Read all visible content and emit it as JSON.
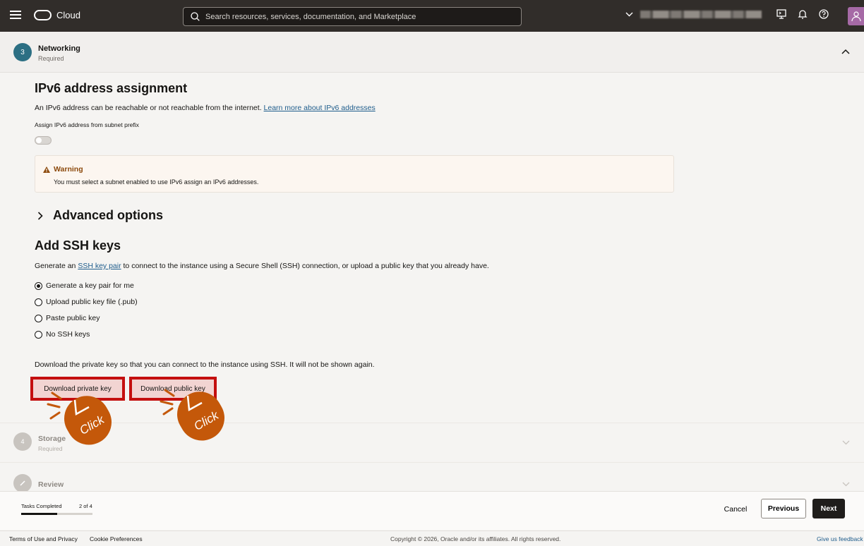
{
  "topbar": {
    "logo_text": "Cloud",
    "search_placeholder": "Search resources, services, documentation, and Marketplace"
  },
  "step3": {
    "number": "3",
    "title": "Networking",
    "subtitle": "Required"
  },
  "ipv6": {
    "heading": "IPv6 address assignment",
    "description": "An IPv6 address can be reachable or not reachable from the internet.",
    "learn_more": "Learn more about IPv6 addresses",
    "toggle_label": "Assign IPv6 address from subnet prefix",
    "toggle_on": false,
    "warning_title": "Warning",
    "warning_message": "You must select a subnet enabled to use IPv6 assign an IPv6 addresses."
  },
  "advanced": {
    "label": "Advanced options"
  },
  "ssh": {
    "heading": "Add SSH keys",
    "desc_prefix": "Generate an",
    "desc_link": "SSH key pair",
    "desc_suffix": "to connect to the instance using a Secure Shell (SSH) connection, or upload a public key that you already have.",
    "options": [
      {
        "label": "Generate a key pair for me",
        "selected": true
      },
      {
        "label": "Upload public key file (.pub)",
        "selected": false
      },
      {
        "label": "Paste public key",
        "selected": false
      },
      {
        "label": "No SSH keys",
        "selected": false
      }
    ],
    "download_note": "Download the private key so that you can connect to the instance using SSH. It will not be shown again.",
    "download_private": "Download private key",
    "download_public": "Download public key",
    "click_label": "Click"
  },
  "step4": {
    "number": "4",
    "title": "Storage",
    "subtitle": "Required"
  },
  "step5": {
    "title": "Review"
  },
  "bottom": {
    "tasks_label": "Tasks Completed",
    "tasks_count": "2 of 4",
    "progress_fraction": 0.5,
    "cancel": "Cancel",
    "previous": "Previous",
    "next": "Next"
  },
  "footer": {
    "terms": "Terms of Use and Privacy",
    "cookies": "Cookie Preferences",
    "copyright": "Copyright © 2026, Oracle and/or its affiliates. All rights reserved.",
    "feedback": "Give us feedback"
  },
  "colors": {
    "accent": "#2c6f83",
    "highlight_red": "#c40f0f",
    "callout_orange": "#c4580a",
    "warning": "#8c4a0d"
  }
}
